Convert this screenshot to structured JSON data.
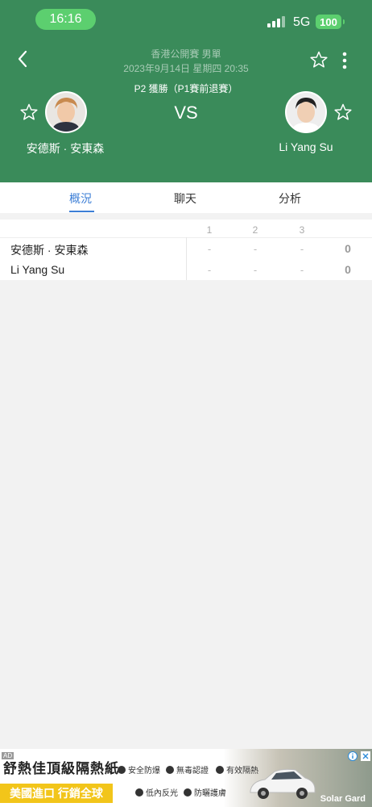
{
  "status_bar": {
    "time": "16:16",
    "network": "5G",
    "battery": "100"
  },
  "header": {
    "event": "香港公開賽 男單",
    "datetime": "2023年9月14日 星期四 20:35",
    "stage": "P2 獲勝（P1賽前退賽）",
    "vs_label": "VS",
    "player1": {
      "name": "安德斯 · 安東森"
    },
    "player2": {
      "name": "Li Yang Su"
    }
  },
  "tabs": [
    {
      "label": "概況",
      "active": true
    },
    {
      "label": "聊天",
      "active": false
    },
    {
      "label": "分析",
      "active": false
    }
  ],
  "scoreboard": {
    "columns": [
      "1",
      "2",
      "3"
    ],
    "rows": [
      {
        "name": "安德斯 · 安東森",
        "sets": [
          "-",
          "-",
          "-"
        ],
        "total": "0"
      },
      {
        "name": "Li Yang Su",
        "sets": [
          "-",
          "-",
          "-"
        ],
        "total": "0"
      }
    ]
  },
  "ad": {
    "label": "AD",
    "title": "舒熱佳頂級隔熱紙",
    "tagline": "美國進口 行銷全球",
    "features": [
      "安全防爆",
      "無毒認證",
      "有效隔熱",
      "低內反光",
      "防曬護膚"
    ],
    "brand": "Solar Gard"
  },
  "colors": {
    "header_bg": "#3a8b5a",
    "accent": "#3d7fd6",
    "status_green": "#5ccf6f"
  }
}
